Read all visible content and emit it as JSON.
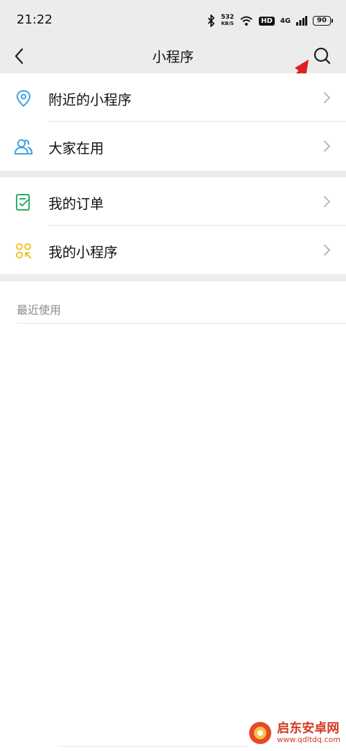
{
  "statusbar": {
    "time": "21:22",
    "net_speed_value": "532",
    "net_speed_unit": "KB/S",
    "hd_badge": "HD",
    "network": "4G",
    "battery": "90",
    "icons": [
      "bluetooth-icon",
      "wifi-icon",
      "signal-icon",
      "battery-icon"
    ]
  },
  "navbar": {
    "title": "小程序",
    "back_icon": "chevron-left-icon",
    "search_icon": "search-icon"
  },
  "menu_group_1": [
    {
      "label": "附近的小程序",
      "icon": "location-pin-icon",
      "icon_color": "#3aa0e0"
    },
    {
      "label": "大家在用",
      "icon": "people-icon",
      "icon_color": "#3aa0e0"
    }
  ],
  "menu_group_2": [
    {
      "label": "我的订单",
      "icon": "order-check-icon",
      "icon_color": "#27ae60"
    },
    {
      "label": "我的小程序",
      "icon": "apps-icon",
      "icon_color": "#f2c12e"
    }
  ],
  "recent": {
    "label": "最近使用"
  },
  "annotation": {
    "arrow_color": "#e02020"
  },
  "watermark": {
    "name": "启东安卓网",
    "url": "www.qdltdq.com"
  }
}
